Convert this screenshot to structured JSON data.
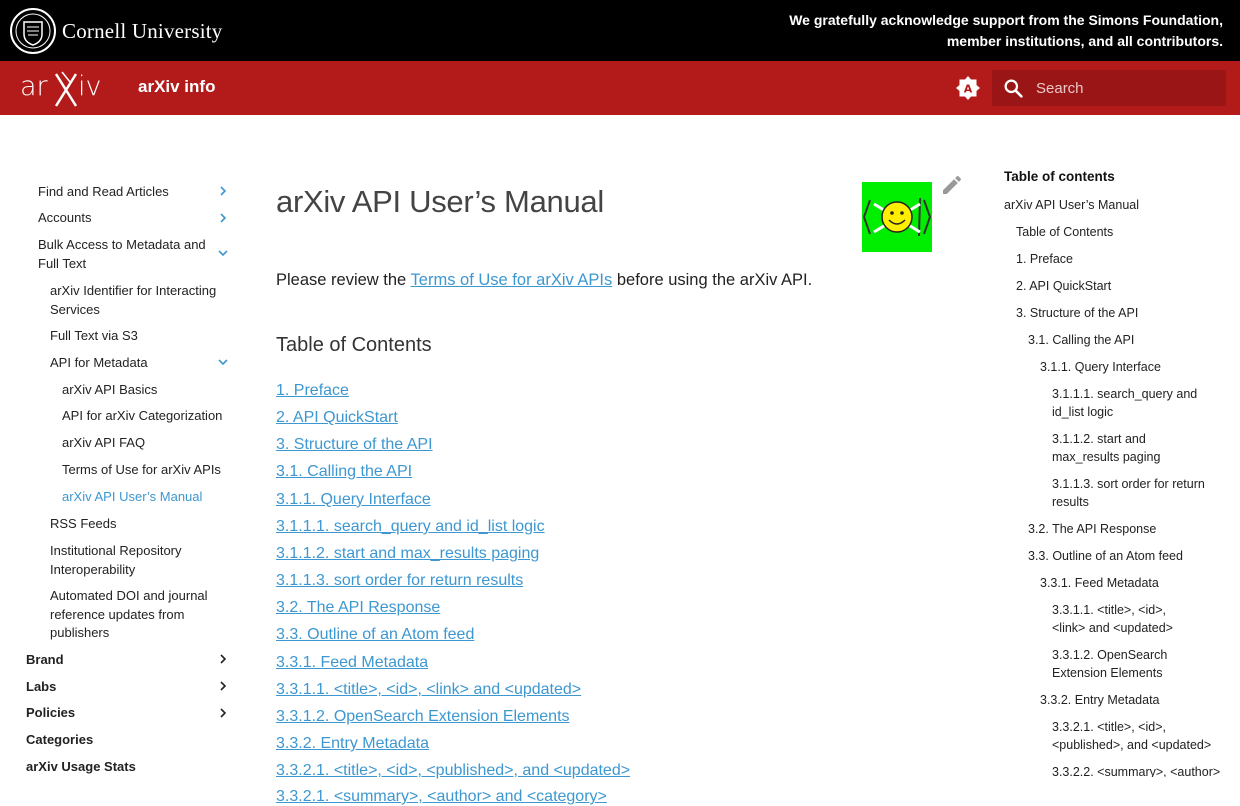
{
  "cornell": {
    "name": "Cornell University",
    "ack_line1": "We gratefully acknowledge support from the Simons Foundation,",
    "ack_line2": "member institutions, and all contributors."
  },
  "header": {
    "site_title": "arXiv info",
    "search_placeholder": "Search",
    "brand_color": "#b31b1b"
  },
  "left_nav": {
    "items": [
      {
        "label": "Find and Read Articles",
        "chevron": "right"
      },
      {
        "label": "Accounts",
        "chevron": "right"
      },
      {
        "label": "Bulk Access to Metadata and Full Text",
        "chevron": "down"
      },
      {
        "label": "arXiv Identifier for Interacting Services"
      },
      {
        "label": "Full Text via S3"
      },
      {
        "label": "API for Metadata",
        "chevron": "down"
      },
      {
        "label": "arXiv API Basics"
      },
      {
        "label": "API for arXiv Categorization"
      },
      {
        "label": "arXiv API FAQ"
      },
      {
        "label": "Terms of Use for arXiv APIs"
      },
      {
        "label": "arXiv API User’s Manual",
        "active": true
      },
      {
        "label": "RSS Feeds"
      },
      {
        "label": "Institutional Repository Interoperability"
      },
      {
        "label": "Automated DOI and journal reference updates from publishers"
      },
      {
        "label": "Brand",
        "chevron": "right"
      },
      {
        "label": "Labs",
        "chevron": "right"
      },
      {
        "label": "Policies",
        "chevron": "right"
      },
      {
        "label": "Categories"
      },
      {
        "label": "arXiv Usage Stats"
      }
    ]
  },
  "main": {
    "title": "arXiv API User’s Manual",
    "intro_prefix": "Please review the ",
    "intro_link": "Terms of Use for arXiv APIs",
    "intro_suffix": " before using the arXiv API.",
    "toc_heading": "Table of Contents",
    "toc": [
      "1. Preface",
      "2. API QuickStart",
      "3. Structure of the API",
      "3.1. Calling the API",
      "3.1.1. Query Interface",
      "3.1.1.1. search_query and id_list logic",
      "3.1.1.2. start and max_results paging",
      "3.1.1.3. sort order for return results",
      "3.2. The API Response",
      "3.3. Outline of an Atom feed",
      "3.3.1. Feed Metadata",
      "3.3.1.1. <title>, <id>, <link> and <updated>",
      "3.3.1.2. OpenSearch Extension Elements",
      "3.3.2. Entry Metadata",
      "3.3.2.1. <title>, <id>, <published>, and <updated>",
      "3.3.2.1. <summary>, <author> and <category>"
    ],
    "link_color": "#3d97d1"
  },
  "right_toc": {
    "title": "Table of contents",
    "items": [
      "arXiv API User’s Manual",
      "Table of Contents",
      "1. Preface",
      "2. API QuickStart",
      "3. Structure of the API",
      "3.1. Calling the API",
      "3.1.1. Query Interface",
      "3.1.1.1. search_query and id_list logic",
      "3.1.1.2. start and max_results paging",
      "3.1.1.3. sort order for return results",
      "3.2. The API Response",
      "3.3. Outline of an Atom feed",
      "3.3.1. Feed Metadata",
      "3.3.1.1. <title>, <id>, <link> and <updated>",
      "3.3.1.2. OpenSearch Extension Elements",
      "3.3.2. Entry Metadata",
      "3.3.2.1. <title>, <id>, <published>, and <updated>",
      "3.3.2.2. <summary>, <author>"
    ]
  }
}
